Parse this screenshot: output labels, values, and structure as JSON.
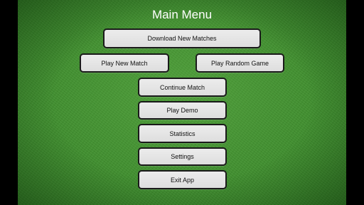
{
  "menu": {
    "title": "Main Menu",
    "buttons": {
      "download_new_matches": "Download New Matches",
      "play_new_match": "Play New Match",
      "play_random_game": "Play Random Game",
      "continue_match": "Continue Match",
      "play_demo": "Play Demo",
      "statistics": "Statistics",
      "settings": "Settings",
      "exit_app": "Exit App"
    }
  },
  "colors": {
    "felt_green": "#3f8f2e",
    "button_fill": "#e5e5e5",
    "button_border": "#1a1a1a",
    "title_text": "#ffffff",
    "side_bars": "#000000"
  }
}
